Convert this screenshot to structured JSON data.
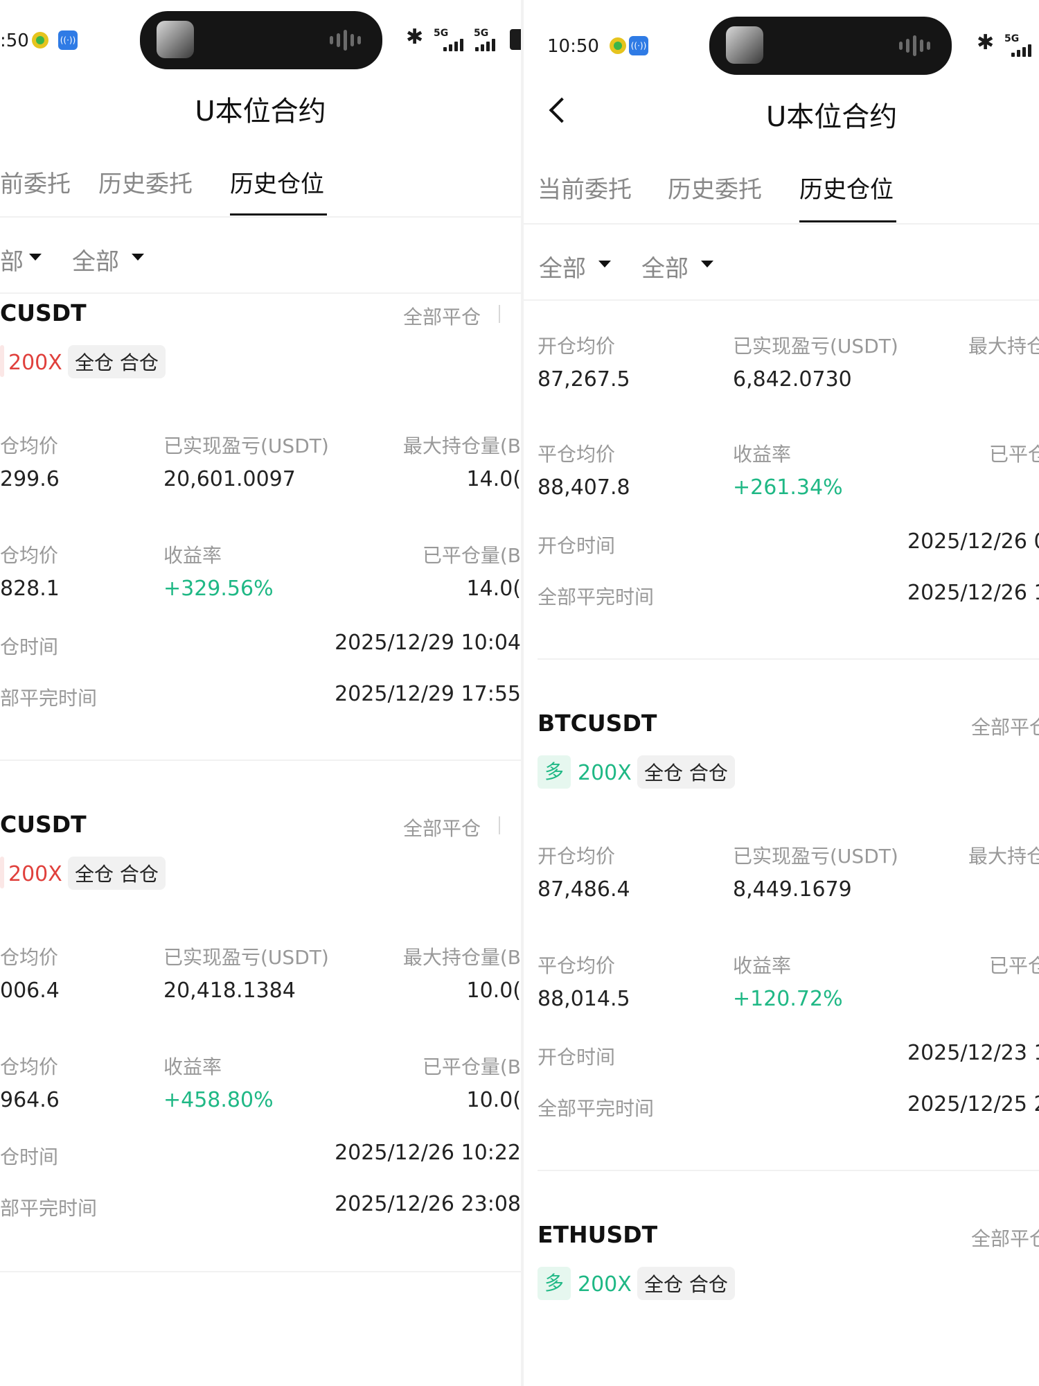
{
  "left": {
    "status": {
      "time": ":50",
      "network1": "5G",
      "network2": "5G"
    },
    "title": "U本位合约",
    "tabs": [
      {
        "label": "前委托"
      },
      {
        "label": "历史委托"
      },
      {
        "label": "历史仓位"
      }
    ],
    "filters": [
      {
        "label": "部"
      },
      {
        "label": "全部"
      }
    ],
    "positions": [
      {
        "symbol": "CUSDT",
        "close_all": "全部平仓",
        "leverage": "200X",
        "margin_mode": "全仓 合仓",
        "open_avg_label": "仓均价",
        "open_avg": "299.6",
        "pnl_label": "已实现盈亏(USDT)",
        "pnl": "20,601.0097",
        "max_pos_label": "最大持仓量(B",
        "max_pos": "14.0(",
        "close_avg_label": "仓均价",
        "close_avg": "828.1",
        "roe_label": "收益率",
        "roe": "+329.56%",
        "closed_qty_label": "已平仓量(B",
        "closed_qty": "14.0(",
        "open_time_label": "仓时间",
        "open_time": "2025/12/29 10:04",
        "close_time_label": "部平完时间",
        "close_time": "2025/12/29 17:55"
      },
      {
        "symbol": "CUSDT",
        "close_all": "全部平仓",
        "leverage": "200X",
        "margin_mode": "全仓 合仓",
        "open_avg_label": "仓均价",
        "open_avg": "006.4",
        "pnl_label": "已实现盈亏(USDT)",
        "pnl": "20,418.1384",
        "max_pos_label": "最大持仓量(B",
        "max_pos": "10.0(",
        "close_avg_label": "仓均价",
        "close_avg": "964.6",
        "roe_label": "收益率",
        "roe": "+458.80%",
        "closed_qty_label": "已平仓量(B",
        "closed_qty": "10.0(",
        "open_time_label": "仓时间",
        "open_time": "2025/12/26 10:22",
        "close_time_label": "部平完时间",
        "close_time": "2025/12/26 23:08"
      }
    ]
  },
  "right": {
    "status": {
      "time": "10:50",
      "network1": "5G"
    },
    "title": "U本位合约",
    "tabs": [
      {
        "label": "当前委托"
      },
      {
        "label": "历史委托"
      },
      {
        "label": "历史仓位"
      }
    ],
    "filters": [
      {
        "label": "全部"
      },
      {
        "label": "全部"
      }
    ],
    "top_position": {
      "open_avg_label": "开仓均价",
      "open_avg": "87,267.5",
      "pnl_label": "已实现盈亏(USDT)",
      "pnl": "6,842.0730",
      "max_pos_label": "最大持仓",
      "close_avg_label": "平仓均价",
      "close_avg": "88,407.8",
      "roe_label": "收益率",
      "roe": "+261.34%",
      "closed_qty_label": "已平仓",
      "open_time_label": "开仓时间",
      "open_time": "2025/12/26 0",
      "close_time_label": "全部平完时间",
      "close_time": "2025/12/26 1"
    },
    "positions": [
      {
        "symbol": "BTCUSDT",
        "close_all": "全部平仓",
        "direction": "多",
        "leverage": "200X",
        "margin_mode": "全仓 合仓",
        "open_avg_label": "开仓均价",
        "open_avg": "87,486.4",
        "pnl_label": "已实现盈亏(USDT)",
        "pnl": "8,449.1679",
        "max_pos_label": "最大持仓",
        "close_avg_label": "平仓均价",
        "close_avg": "88,014.5",
        "roe_label": "收益率",
        "roe": "+120.72%",
        "closed_qty_label": "已平仓",
        "open_time_label": "开仓时间",
        "open_time": "2025/12/23 1",
        "close_time_label": "全部平完时间",
        "close_time": "2025/12/25 2"
      },
      {
        "symbol": "ETHUSDT",
        "close_all": "全部平仓",
        "direction": "多",
        "leverage": "200X",
        "margin_mode": "全仓 合仓"
      }
    ]
  }
}
